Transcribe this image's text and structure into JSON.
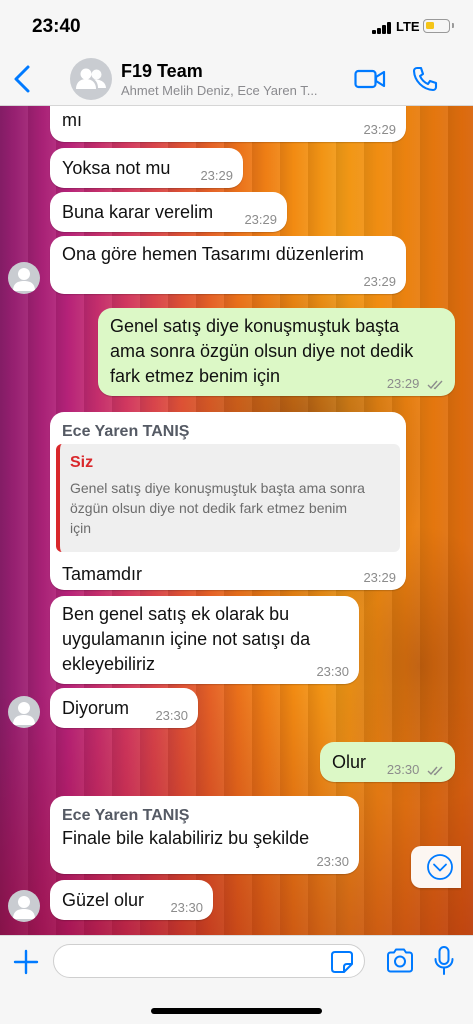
{
  "status_bar": {
    "time": "23:40",
    "network": "LTE",
    "battery_level": 0.35,
    "signal_bars": 4
  },
  "header": {
    "title": "F19 Team",
    "members": "Ahmet Melih Deniz, Ece Yaren T..."
  },
  "messages": [
    {
      "type": "in",
      "text": "mı",
      "time": "23:29"
    },
    {
      "type": "in",
      "text": "Yoksa not mu",
      "time": "23:29"
    },
    {
      "type": "in",
      "text": "Buna karar verelim",
      "time": "23:29"
    },
    {
      "type": "in",
      "text": "Ona göre hemen Tasarımı düzenlerim",
      "time": "23:29"
    },
    {
      "type": "out",
      "text_lines": [
        "Genel satış diye konuşmuştuk başta",
        "ama sonra özgün olsun diye not dedik",
        "fark etmez benim için"
      ],
      "time": "23:29",
      "status": "read"
    },
    {
      "type": "in",
      "sender": "Ece Yaren TANIŞ",
      "quote": {
        "author": "Siz",
        "text_lines": [
          "Genel satış diye konuşmuştuk başta ama sonra",
          "özgün olsun diye not dedik fark etmez benim",
          "için"
        ]
      },
      "text": "Tamamdır",
      "time": "23:29"
    },
    {
      "type": "in",
      "text_lines": [
        "Ben genel satış ek olarak bu",
        "uygulamanın içine not satışı da",
        "ekleyebiliriz"
      ],
      "time": "23:30"
    },
    {
      "type": "in",
      "text": "Diyorum",
      "time": "23:30"
    },
    {
      "type": "out",
      "text": "Olur",
      "time": "23:30",
      "status": "read"
    },
    {
      "type": "in",
      "sender": "Ece Yaren TANIŞ",
      "text": "Finale bile kalabiliriz bu şekilde",
      "time": "23:30"
    },
    {
      "type": "in",
      "text": "Güzel olur",
      "time": "23:30"
    }
  ],
  "composer": {
    "placeholder": ""
  },
  "colors": {
    "accent": "#007aff",
    "outgoing_bubble": "#dcf8c6",
    "incoming_bubble": "#ffffff",
    "quote_author": "#d9272b",
    "read_ticks": "#8c8c8c"
  }
}
